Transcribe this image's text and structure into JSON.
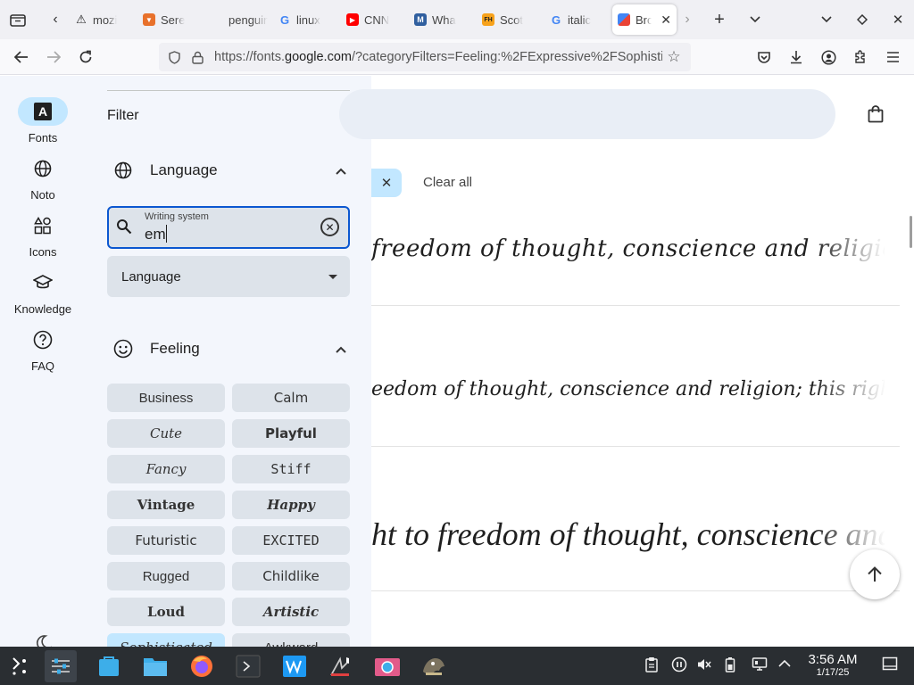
{
  "browser": {
    "tabs": [
      {
        "title": "mozi",
        "favicon": "warning-icon",
        "color": "#222222"
      },
      {
        "title": "Sere",
        "favicon": "shield-icon",
        "color": "#e8712b"
      },
      {
        "title": "penguin",
        "favicon": "blank-icon",
        "color": "#f0f0f4"
      },
      {
        "title": "linux",
        "favicon": "google-icon",
        "color": "#4285f4"
      },
      {
        "title": "CNN",
        "favicon": "youtube-icon",
        "color": "#ff0000"
      },
      {
        "title": "Wha",
        "favicon": "merriam-webster-icon",
        "color": "#305f9f"
      },
      {
        "title": "Scot",
        "favicon": "fh-icon",
        "color": "#f7a21b"
      },
      {
        "title": "italic",
        "favicon": "google-icon",
        "color": "#4285f4"
      },
      {
        "title": "Bro",
        "favicon": "google-fonts-icon",
        "color": "#4285f4"
      }
    ],
    "url_prefix": "https://fonts.",
    "url_domain": "google.com",
    "url_rest": "/?categoryFilters=Feeling:%2FExpressive%2FSophisti"
  },
  "rail": {
    "items": [
      {
        "label": "Fonts",
        "icon": "A"
      },
      {
        "label": "Noto",
        "icon": "globe"
      },
      {
        "label": "Icons",
        "icon": "shapes"
      },
      {
        "label": "Knowledge",
        "icon": "school"
      },
      {
        "label": "FAQ",
        "icon": "?"
      }
    ]
  },
  "filter": {
    "title": "Filter",
    "language_section": "Language",
    "writing_system_label": "Writing system",
    "writing_system_value": "em",
    "language_select": "Language",
    "feeling_section": "Feeling",
    "feeling_chips": [
      {
        "label": "Business",
        "font": "\"Liberation Sans\", sans-serif",
        "style": "normal",
        "weight": "normal"
      },
      {
        "label": "Calm",
        "font": "\"DejaVu Sans\", sans-serif",
        "style": "normal",
        "weight": "normal"
      },
      {
        "label": "Cute",
        "font": "\"DejaVu Serif\", serif",
        "style": "italic",
        "weight": "normal"
      },
      {
        "label": "Playful",
        "font": "\"DejaVu Sans\", sans-serif",
        "style": "normal",
        "weight": "bold"
      },
      {
        "label": "Fancy",
        "font": "\"DejaVu Serif\", serif",
        "style": "italic",
        "weight": "normal"
      },
      {
        "label": "Stiff",
        "font": "\"DejaVu Sans Mono\", monospace",
        "style": "normal",
        "weight": "normal"
      },
      {
        "label": "Vintage",
        "font": "\"DejaVu Serif\", serif",
        "style": "normal",
        "weight": "bold"
      },
      {
        "label": "Happy",
        "font": "\"DejaVu Serif\", serif",
        "style": "italic",
        "weight": "bold"
      },
      {
        "label": "Futuristic",
        "font": "\"DejaVu Sans\", sans-serif",
        "style": "normal",
        "weight": "normal"
      },
      {
        "label": "EXCITED",
        "font": "\"DejaVu Sans Mono\", monospace",
        "style": "normal",
        "weight": "normal"
      },
      {
        "label": "Rugged",
        "font": "\"Liberation Sans\", sans-serif",
        "style": "normal",
        "weight": "normal"
      },
      {
        "label": "Childlike",
        "font": "\"DejaVu Sans\", sans-serif",
        "style": "normal",
        "weight": "normal"
      },
      {
        "label": "Loud",
        "font": "\"DejaVu Serif\", serif",
        "style": "normal",
        "weight": "bold"
      },
      {
        "label": "Artistic",
        "font": "\"DejaVu Serif\", serif",
        "style": "italic",
        "weight": "bold"
      },
      {
        "label": "Sophisticated",
        "font": "\"DejaVu Serif\", serif",
        "style": "italic",
        "weight": "normal",
        "selected": true
      },
      {
        "label": "Awkward",
        "font": "\"Liberation Sans\", sans-serif",
        "style": "normal",
        "weight": "normal"
      }
    ]
  },
  "main": {
    "clear_all": "Clear all",
    "samples": [
      "freedom of thought, conscience and religion; this r",
      "eedom of thought, conscience and religion; this right include",
      "ht to freedom of thought, conscience and r"
    ]
  },
  "taskbar": {
    "time": "3:56 AM",
    "date": "1/17/25"
  },
  "colors": {
    "accent": "#0b57d0",
    "chip_selected": "#c2e7ff",
    "panel_bg": "#f3f6fc",
    "taskbar_bg": "#2a2e32"
  }
}
